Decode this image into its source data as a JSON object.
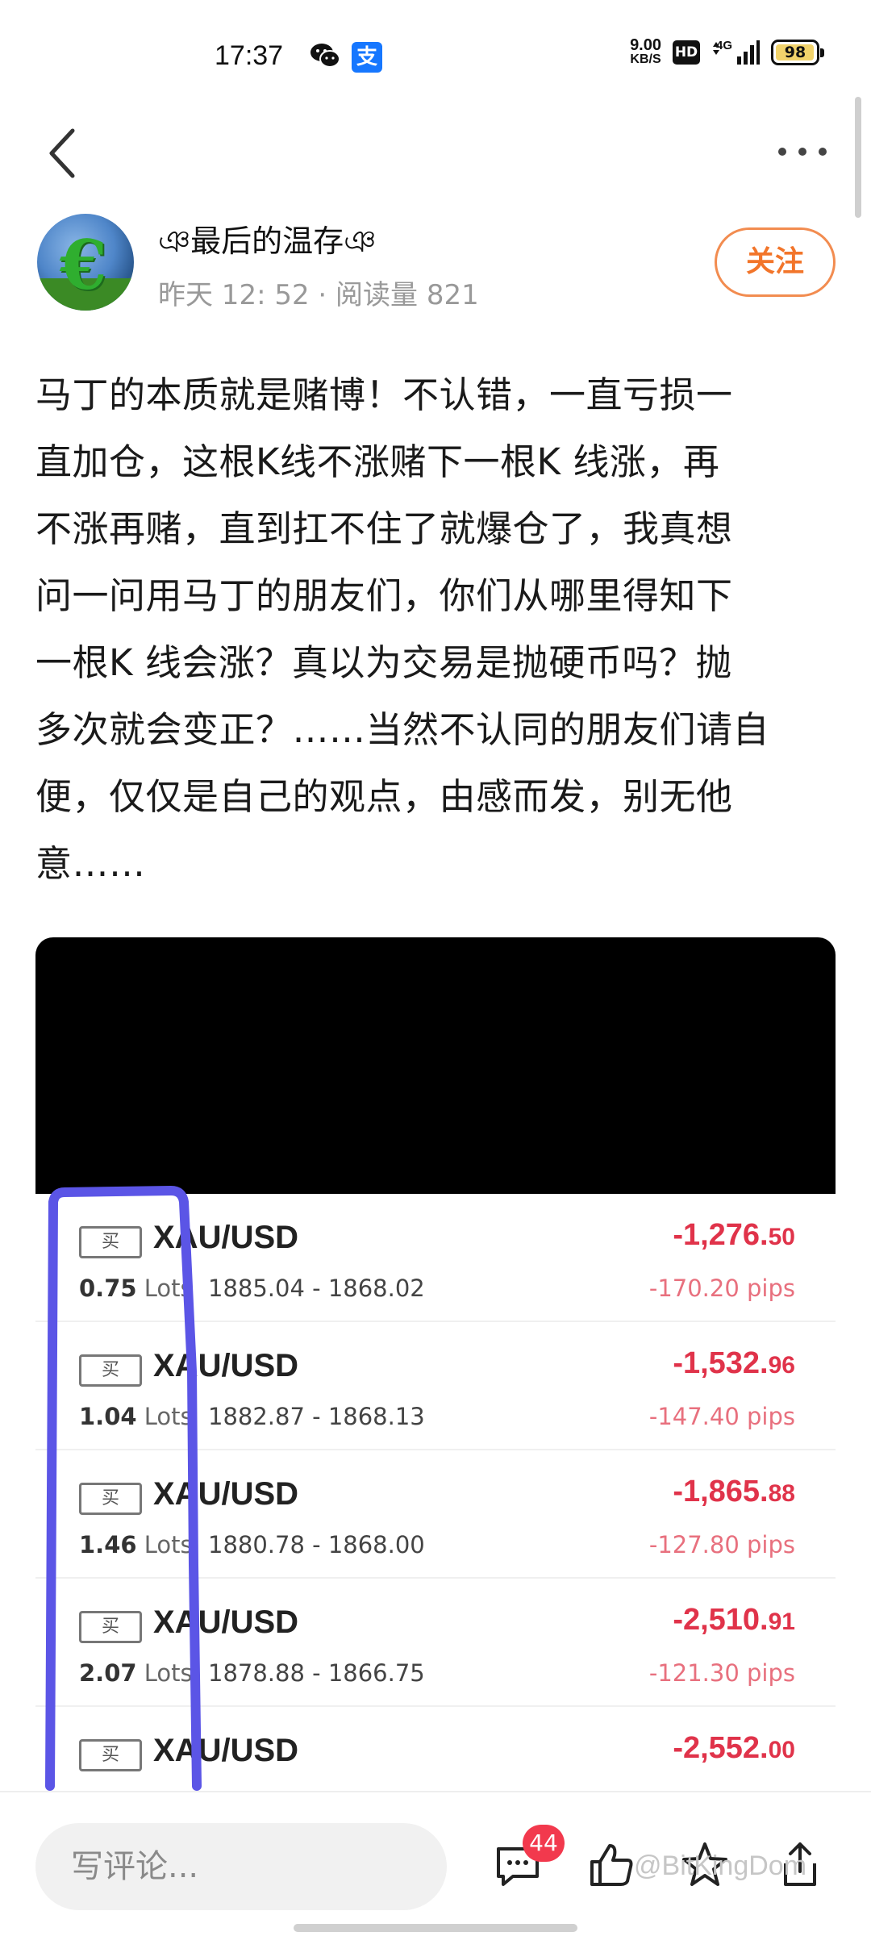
{
  "status_bar": {
    "time": "17:37",
    "speed_value": "9.00",
    "speed_unit": "KB/S",
    "hd": "HD",
    "network": "4G",
    "battery": "98",
    "alipay_glyph": "支"
  },
  "nav": {
    "back_icon": "chevron-left-icon",
    "more_icon": "more-horizontal-icon"
  },
  "author": {
    "name": "ঞ最后的温存ঞ",
    "meta": "昨天 12: 52 · 阅读量 821",
    "follow_label": "关注"
  },
  "post": {
    "lines": [
      "马丁的本质就是赌博！不认错，一直亏损一",
      "直加仓，这根K线不涨赌下一根K 线涨，再",
      "不涨再赌，直到扛不住了就爆仓了，我真想",
      "问一问用马丁的朋友们，你们从哪里得知下",
      "一根K 线会涨？真以为交易是抛硬币吗？抛",
      "多次就会变正？……当然不认同的朋友们请自",
      "便，仅仅是自己的观点，由感而发，别无他",
      "意……"
    ]
  },
  "trades": [
    {
      "tag": "买",
      "symbol": "XAU/USD",
      "lots": "0.75",
      "lots_unit": "Lots",
      "range": "1885.04 - 1868.02",
      "pl_main": "-1,276.",
      "pl_cents": "50",
      "pips": "-170.20 pips"
    },
    {
      "tag": "买",
      "symbol": "XAU/USD",
      "lots": "1.04",
      "lots_unit": "Lots",
      "range": "1882.87 - 1868.13",
      "pl_main": "-1,532.",
      "pl_cents": "96",
      "pips": "-147.40 pips"
    },
    {
      "tag": "买",
      "symbol": "XAU/USD",
      "lots": "1.46",
      "lots_unit": "Lots",
      "range": "1880.78 - 1868.00",
      "pl_main": "-1,865.",
      "pl_cents": "88",
      "pips": "-127.80 pips"
    },
    {
      "tag": "买",
      "symbol": "XAU/USD",
      "lots": "2.07",
      "lots_unit": "Lots",
      "range": "1878.88 - 1866.75",
      "pl_main": "-2,510.",
      "pl_cents": "91",
      "pips": "-121.30 pips"
    },
    {
      "tag": "买",
      "symbol": "XAU/USD",
      "lots": "",
      "lots_unit": "",
      "range": "",
      "pl_main": "-2,552.",
      "pl_cents": "00",
      "pips": ""
    }
  ],
  "colors": {
    "loss": "#e0334a",
    "pips": "#e8707e",
    "follow": "#f2752a",
    "annotation": "#5b55e6",
    "badge": "#f2394d"
  },
  "bottom_bar": {
    "comment_placeholder": "写评论...",
    "comment_count": "44",
    "icons": [
      "comment-icon",
      "like-icon",
      "star-icon",
      "share-icon"
    ],
    "watermark": "@BitKingDom"
  }
}
